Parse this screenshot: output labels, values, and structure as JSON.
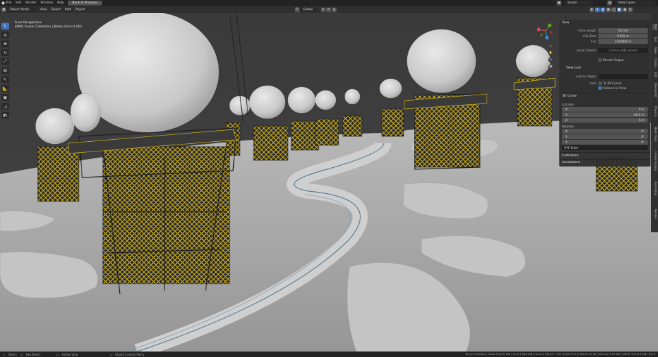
{
  "app": {
    "menus": [
      "File",
      "Edit",
      "Render",
      "Window",
      "Help"
    ],
    "back_button": "Back to Previous",
    "scene_label": "Scene",
    "view_layer_label": "View Layer"
  },
  "header": {
    "mode": "Object Mode",
    "menus": [
      "View",
      "Select",
      "Add",
      "Object"
    ],
    "orientation": "Global",
    "options_label": "Options"
  },
  "viewport": {
    "perspective": "User Perspective",
    "collection_line": "(496) Scene Collection | Brake Front R.003"
  },
  "npanel": {
    "view_header": "View",
    "focal_length_label": "Focal Length",
    "focal_length_value": "50 mm",
    "clip_start_label": "Clip Start",
    "clip_start_value": "0.101 m",
    "end_label": "End",
    "end_value": "1000000 m",
    "local_camera_label": "Local Camera",
    "local_camera_value": "Camera_DJR_wheels",
    "render_region_label": "Render Region",
    "view_lock_header": "View Lock",
    "lock_to_object_label": "Lock to Object",
    "lock_label": "Lock",
    "to_3d_cursor_label": "To 3D Cursor",
    "camera_to_view_label": "Camera to View",
    "cursor_header": "3D Cursor",
    "location_label": "Location",
    "x_label": "X",
    "x_value": "0 m",
    "y_label": "Y",
    "y_value": "-20.5 m",
    "z_label": "Z",
    "z_value": "0 m",
    "rotation_label": "Rotation",
    "rx_label": "X",
    "rx_value": "0°",
    "ry_label": "Y",
    "ry_value": "0°",
    "rz_label": "Z",
    "rz_value": "0°",
    "rotation_mode": "XYZ Euler",
    "collections_header": "Collections",
    "annotations_header": "Annotations"
  },
  "side_tabs": [
    "Item",
    "Tool",
    "View",
    "Create",
    "Edit",
    "BlenderKit",
    "Physics",
    "Mesh Tools",
    "Unreal Engine",
    "Animation",
    "Render"
  ],
  "status_bar": {
    "left1": "Select",
    "left2": "Box Select",
    "left3": "Rotate View",
    "left4": "Object Context Menu",
    "right": "Scene Collection | Brake Front R.003 | Verts 5,646,444 | Faces 2,733,221 | Tris 10,207,613 | Objects 1/138 | Memory: 4.59 GiB | VRAM: 3.4/11.0 GiB | 3.0.0"
  }
}
